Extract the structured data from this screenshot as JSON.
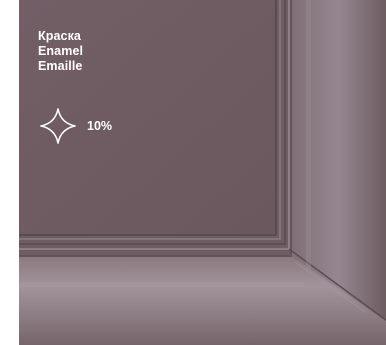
{
  "labels": {
    "ru": "Краска",
    "en": "Enamel",
    "fr": "Emaille"
  },
  "gloss": {
    "icon": "sparkle-icon",
    "value": "10%"
  },
  "colors": {
    "enamel": "#6e5d62",
    "text": "#ffffff"
  }
}
